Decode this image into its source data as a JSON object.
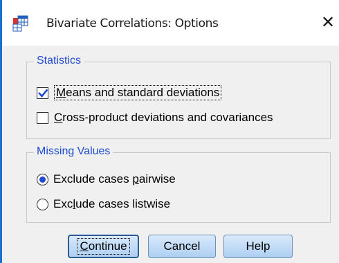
{
  "window": {
    "title": "Bivariate Correlations: Options",
    "close_glyph": "✕"
  },
  "statistics": {
    "legend": "Statistics",
    "means": {
      "label_mnemonic": "M",
      "label_rest": "eans and standard deviations",
      "checked": true
    },
    "crossproduct": {
      "label_mnemonic": "C",
      "label_rest": "ross-product deviations and covariances",
      "checked": false
    }
  },
  "missing_values": {
    "legend": "Missing Values",
    "pairwise": {
      "label_pre": "Exclude cases ",
      "label_mnemonic": "p",
      "label_post": "airwise",
      "selected": true
    },
    "listwise": {
      "label_pre": "Exc",
      "label_mnemonic": "l",
      "label_post": "ude cases listwise",
      "selected": false
    }
  },
  "buttons": {
    "continue": {
      "label_mnemonic": "C",
      "label_rest": "ontinue"
    },
    "cancel": "Cancel",
    "help": "Help"
  },
  "colors": {
    "accent": "#1f4bd0",
    "check": "#1f4bd0",
    "window_edge": "#1f6fd0"
  },
  "icons": {
    "app": "spss-table-icon",
    "close": "close-icon"
  }
}
